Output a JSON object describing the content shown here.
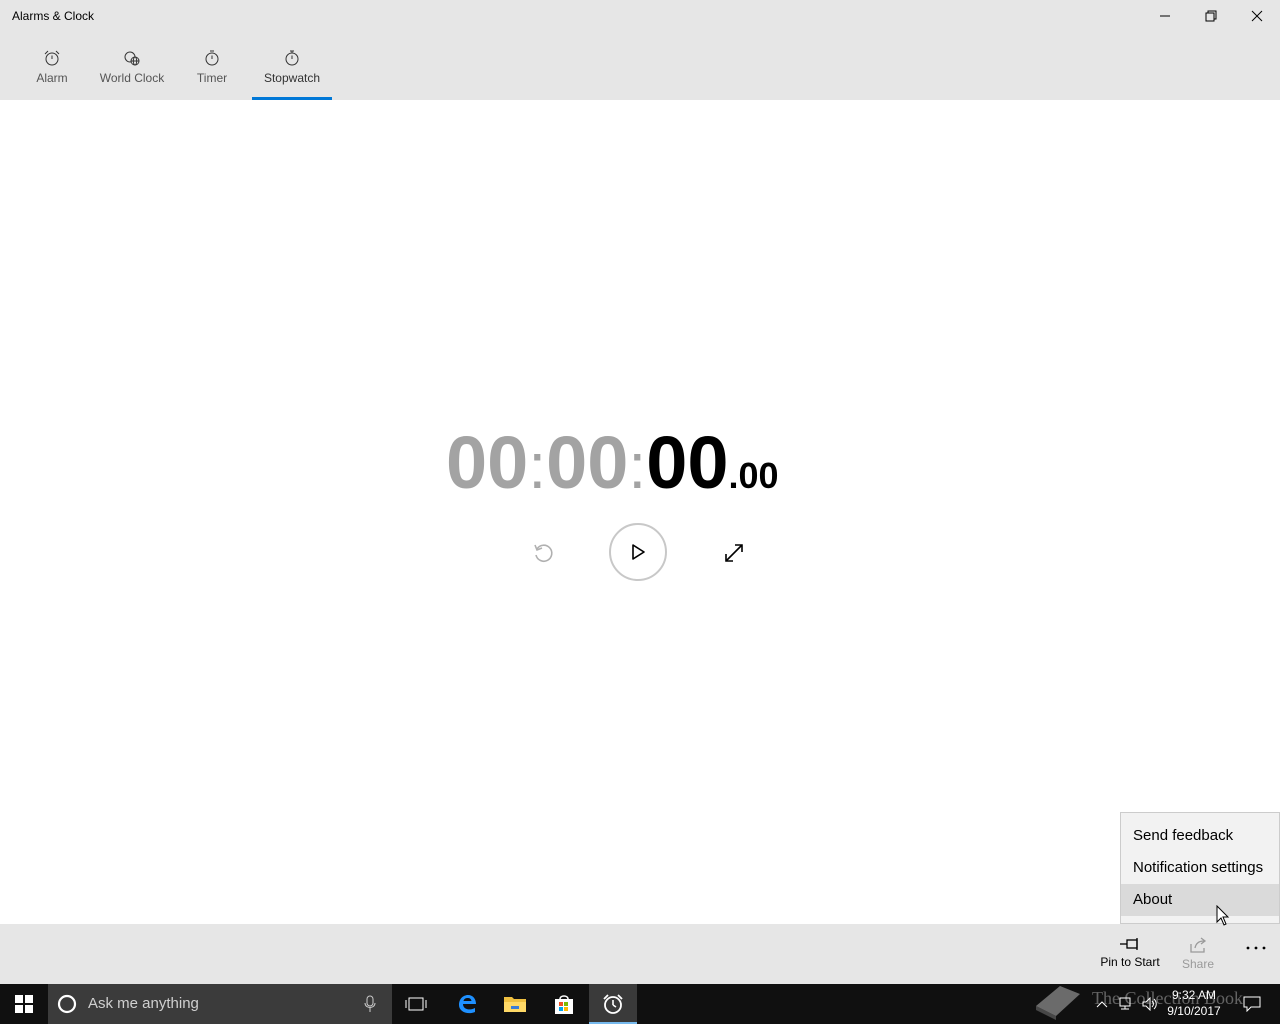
{
  "window": {
    "title": "Alarms & Clock",
    "controls": {
      "minimize": "minimize-icon",
      "restore": "restore-icon",
      "close": "close-icon"
    }
  },
  "tabs": [
    {
      "label": "Alarm",
      "icon": "alarm-icon"
    },
    {
      "label": "World Clock",
      "icon": "globe-clock-icon"
    },
    {
      "label": "Timer",
      "icon": "timer-icon"
    },
    {
      "label": "Stopwatch",
      "icon": "stopwatch-icon",
      "selected": true
    }
  ],
  "stopwatch": {
    "hours": "00",
    "minutes": "00",
    "seconds": "00",
    "hundredths": ".00",
    "separator": ":"
  },
  "controls": {
    "reset": "reset-icon",
    "play": "play-icon",
    "expand": "expand-icon"
  },
  "menu": {
    "items": [
      {
        "label": "Send feedback"
      },
      {
        "label": "Notification settings"
      },
      {
        "label": "About",
        "hovered": true
      }
    ]
  },
  "appbar": {
    "pin_label": "Pin to Start",
    "share_label": "Share",
    "more": "more-icon"
  },
  "taskbar": {
    "search_placeholder": "Ask me anything",
    "time": "9:32 AM",
    "date": "9/10/2017",
    "watermark": "The Collection Book"
  },
  "colors": {
    "accent": "#0078d7",
    "chrome": "#e6e6e6",
    "dim_digits": "#a3a3a3",
    "taskbar": "#101010"
  }
}
